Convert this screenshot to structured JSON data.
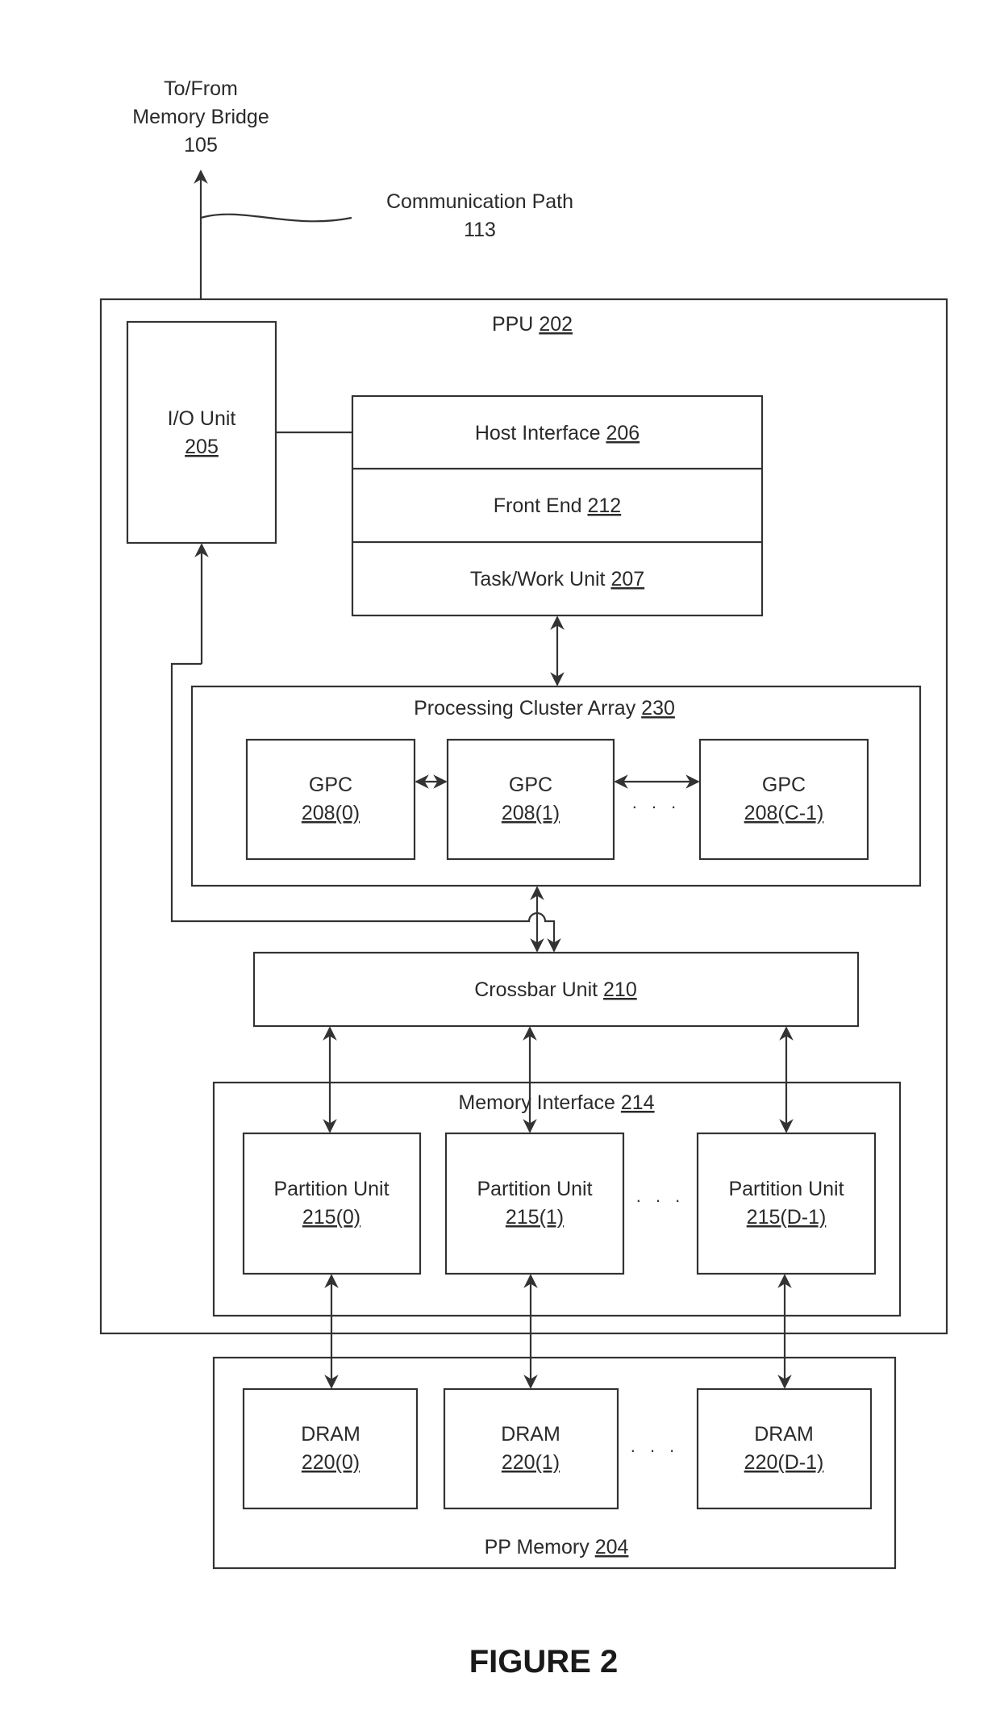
{
  "figure_title": "FIGURE 2",
  "external": {
    "memory_bridge": {
      "line1": "To/From",
      "line2": "Memory Bridge",
      "ref": "105"
    },
    "communication_path": {
      "line1": "Communication Path",
      "ref": "113"
    }
  },
  "ppu": {
    "label": "PPU",
    "ref": "202"
  },
  "io_unit": {
    "label": "I/O Unit",
    "ref": "205"
  },
  "host_stack": [
    {
      "label": "Host Interface",
      "ref": "206"
    },
    {
      "label": "Front End",
      "ref": "212"
    },
    {
      "label": "Task/Work Unit",
      "ref": "207"
    }
  ],
  "processing_cluster_array": {
    "label": "Processing Cluster Array",
    "ref": "230"
  },
  "gpcs": [
    {
      "label": "GPC",
      "ref": "208(0)"
    },
    {
      "label": "GPC",
      "ref": "208(1)"
    },
    {
      "label": "GPC",
      "ref": "208(C-1)"
    }
  ],
  "crossbar": {
    "label": "Crossbar Unit",
    "ref": "210"
  },
  "memory_interface": {
    "label": "Memory Interface",
    "ref": "214"
  },
  "partition_units": [
    {
      "label": "Partition Unit",
      "ref": "215(0)"
    },
    {
      "label": "Partition Unit",
      "ref": "215(1)"
    },
    {
      "label": "Partition Unit",
      "ref": "215(D-1)"
    }
  ],
  "pp_memory": {
    "label": "PP Memory",
    "ref": "204"
  },
  "drams": [
    {
      "label": "DRAM",
      "ref": "220(0)"
    },
    {
      "label": "DRAM",
      "ref": "220(1)"
    },
    {
      "label": "DRAM",
      "ref": "220(D-1)"
    }
  ],
  "ellipsis": ". . ."
}
